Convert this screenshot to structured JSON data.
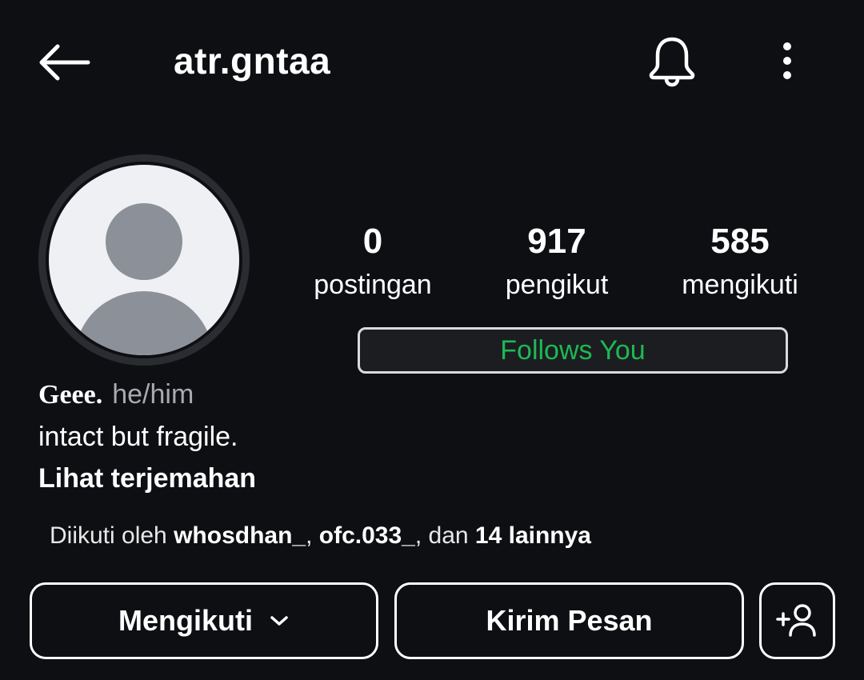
{
  "header": {
    "username": "atr.gntaa",
    "back_icon": "arrow-left-icon",
    "notification_icon": "bell-icon",
    "more_icon": "vertical-ellipsis-icon"
  },
  "profile": {
    "avatar_icon": "default-avatar-icon",
    "stats": [
      {
        "value": "0",
        "label": "postingan"
      },
      {
        "value": "917",
        "label": "pengikut"
      },
      {
        "value": "585",
        "label": "mengikuti"
      }
    ],
    "follows_you": "Follows You",
    "display_name": "Geee.",
    "pronouns": "he/him",
    "bio": "intact but fragile.",
    "translate_link": "Lihat terjemahan"
  },
  "followed_by": {
    "prefix": "Diikuti oleh ",
    "user1": "whosdhan_",
    "sep1": ", ",
    "user2": "ofc.033_",
    "sep2": ", dan ",
    "others": "14 lainnya"
  },
  "actions": {
    "following_label": "Mengikuti",
    "message_label": "Kirim Pesan",
    "add_user_icon": "add-person-icon"
  },
  "colors": {
    "background": "#0e0f13",
    "follows_you_green": "#1db954",
    "pronoun_gray": "#a8aab0"
  }
}
